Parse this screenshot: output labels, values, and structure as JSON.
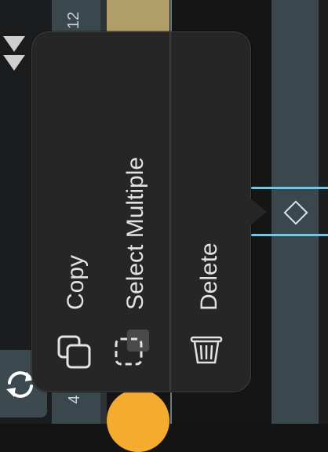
{
  "timeline": {
    "track_number_top": "12",
    "track_number_bottom": "4",
    "colors": {
      "track": "#3a474d",
      "clip_gold": "#b09d68",
      "clip_orange": "#f4ab2e",
      "keyframe_line": "#7cc4da"
    }
  },
  "context_menu": {
    "items": [
      {
        "label": "Copy",
        "icon": "copy-icon"
      },
      {
        "label": "Select Multiple",
        "icon": "select-multiple-icon"
      },
      {
        "label": "Delete",
        "icon": "trash-icon"
      }
    ]
  },
  "icons": {
    "sync": "sync-icon",
    "collapse": "double-chevron-down-icon",
    "keyframe": "diamond-icon"
  }
}
